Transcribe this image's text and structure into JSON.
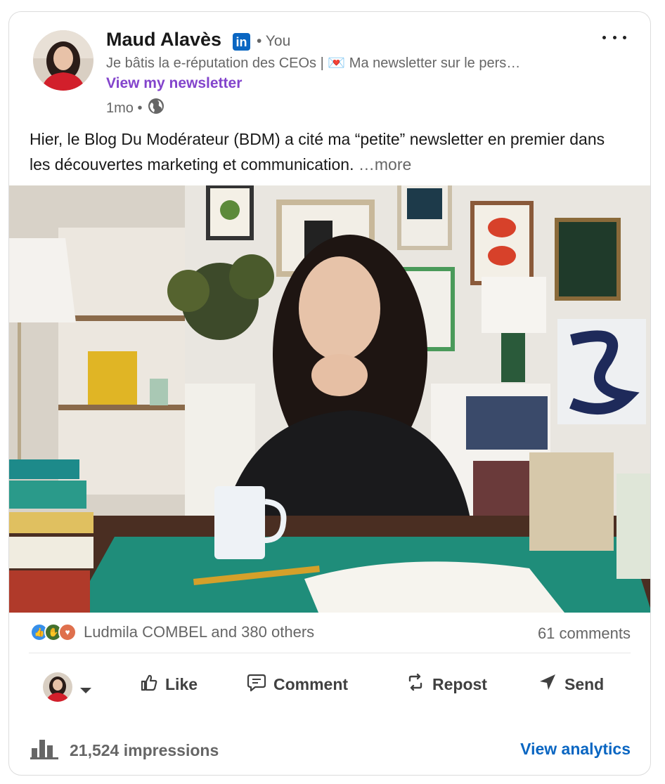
{
  "author": {
    "name": "Maud Alavès",
    "linkedin_badge": "in",
    "relation": "• You",
    "headline": "Je bâtis la e-réputation des CEOs | 💌 Ma newsletter sur le pers…",
    "newsletter_link": "View my newsletter",
    "time": "1mo •"
  },
  "post": {
    "text": "Hier, le Blog Du Modérateur (BDM) a cité ma “petite” newsletter en premier dans les découvertes marketing et communication.",
    "see_more": "…more"
  },
  "social": {
    "reactors": "Ludmila COMBEL and 380 others",
    "comments": "61 comments"
  },
  "actions": {
    "like": "Like",
    "comment": "Comment",
    "repost": "Repost",
    "send": "Send"
  },
  "footer": {
    "impressions": "21,524 impressions",
    "view_analytics": "View analytics"
  },
  "colors": {
    "link_purple": "#8344cc",
    "linkedin_blue": "#0a66c2"
  }
}
